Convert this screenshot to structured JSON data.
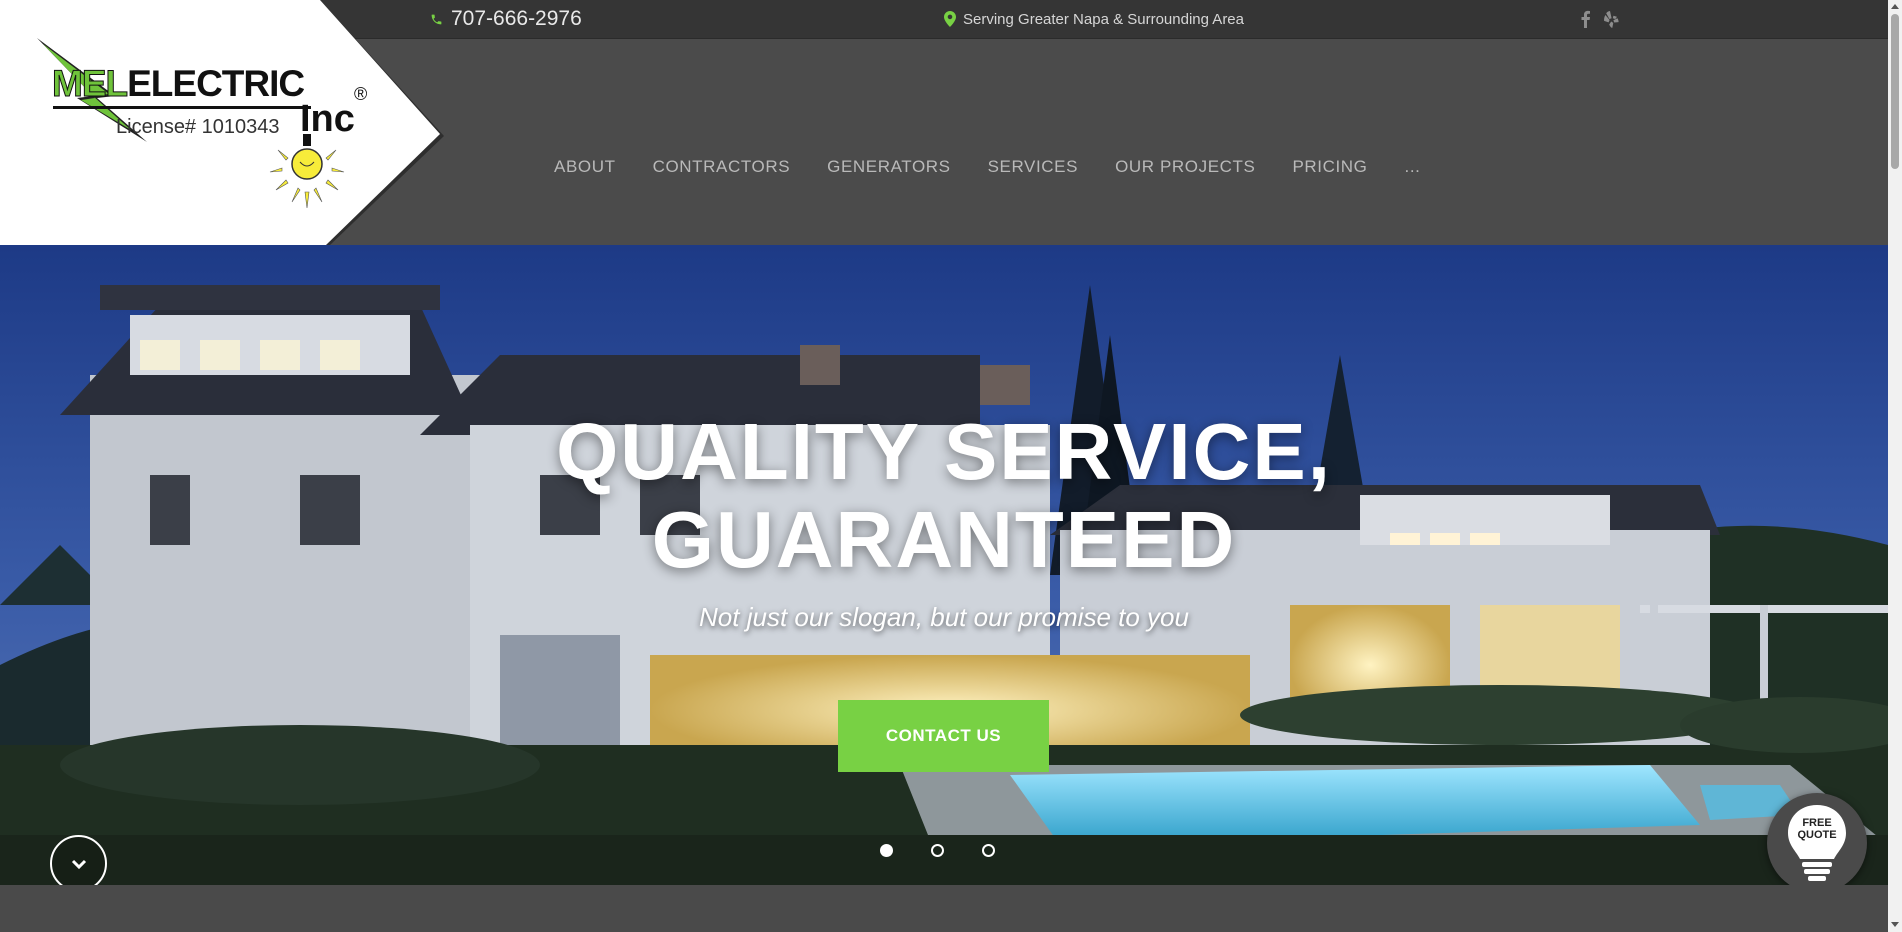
{
  "topbar": {
    "phone": "707-666-2976",
    "location": "Serving Greater Napa & Surrounding Area",
    "social": [
      {
        "icon": "facebook-icon"
      },
      {
        "icon": "yelp-icon"
      }
    ]
  },
  "logo": {
    "brand_part1": "MEL",
    "brand_part2": "ELECTRIC",
    "suffix": "Inc",
    "registered": "®",
    "license": "License# 1010343"
  },
  "nav": {
    "items": [
      {
        "label": "ABOUT"
      },
      {
        "label": "CONTRACTORS"
      },
      {
        "label": "GENERATORS"
      },
      {
        "label": "SERVICES"
      },
      {
        "label": "OUR PROJECTS"
      },
      {
        "label": "PRICING"
      },
      {
        "label": "..."
      }
    ]
  },
  "hero": {
    "title_line1": "QUALITY SERVICE,",
    "title_line2": "GUARANTEED",
    "subtitle": "Not just our slogan, but our promise to you",
    "cta_label": "CONTACT US",
    "slides": 3,
    "active_slide": 1
  },
  "quote": {
    "line1": "FREE",
    "line2": "QUOTE"
  },
  "colors": {
    "accent": "#78d144",
    "topbar": "#353535",
    "header": "#4b4b4b"
  }
}
